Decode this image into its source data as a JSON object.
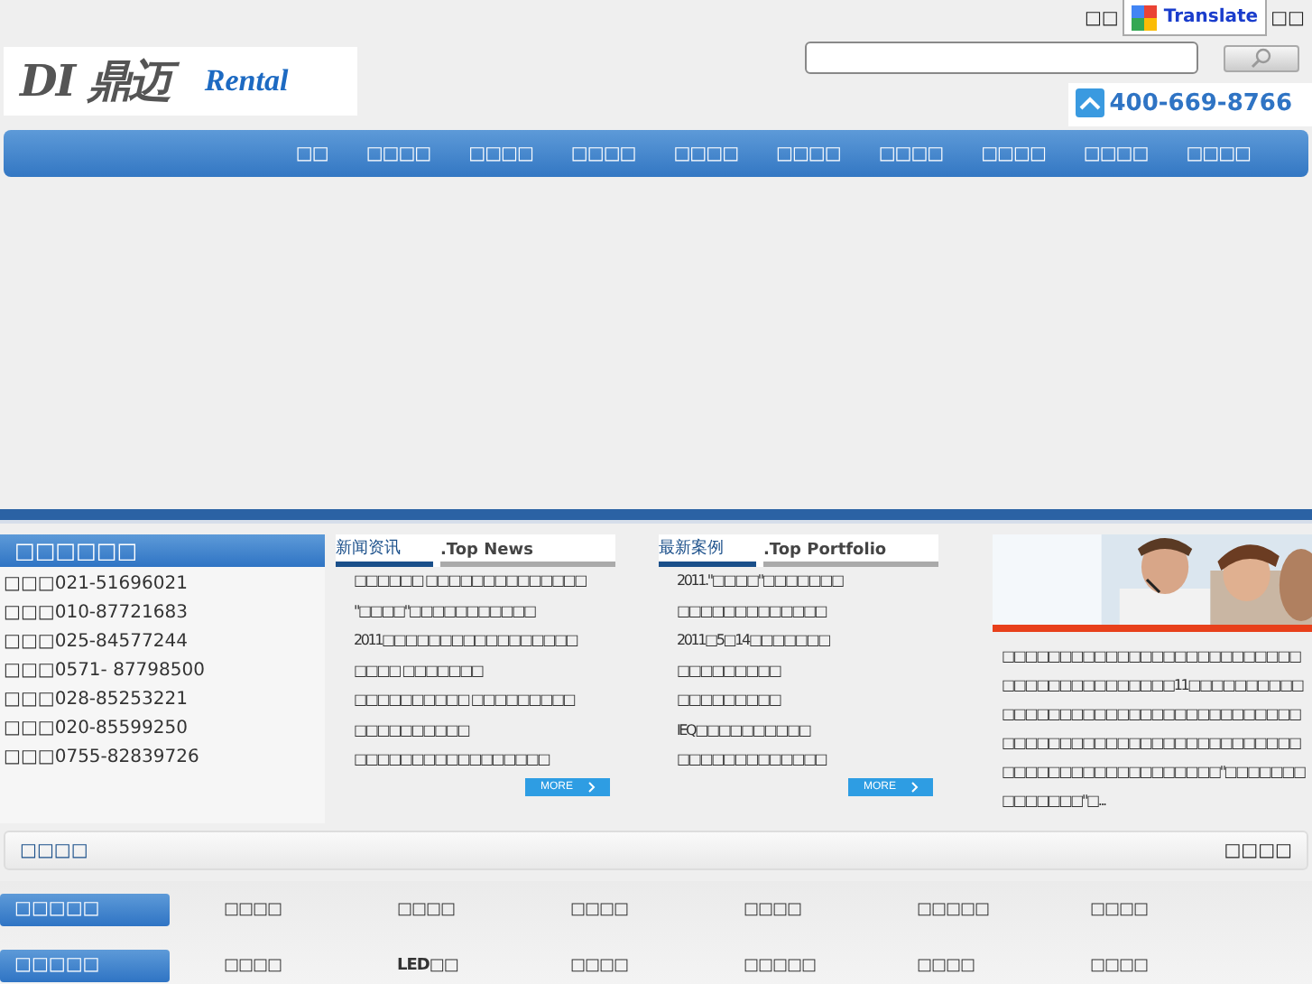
{
  "top_links": [
    "□□",
    "□□"
  ],
  "translate": {
    "label": "Translate"
  },
  "logo": {
    "mark": "DI 鼎迈",
    "tagline": "Rental"
  },
  "hotline": "400-669-8766",
  "nav": [
    {
      "label": "□□",
      "selected": false
    },
    {
      "label": "□□□□",
      "selected": false
    },
    {
      "label": "□□□□",
      "selected": false
    },
    {
      "label": "□□□□",
      "selected": false
    },
    {
      "label": "□□□□",
      "selected": false
    },
    {
      "label": "□□□□",
      "selected": false
    },
    {
      "label": "□□□□",
      "selected": false
    },
    {
      "label": "□□□□",
      "selected": false
    },
    {
      "label": "□□□□",
      "selected": false
    },
    {
      "label": "□□□□",
      "selected": false
    }
  ],
  "contacts": {
    "title": "□□□□□□",
    "lines": [
      "□□□021-51696021",
      "□□□010-87721683",
      "□□□025-84577244",
      "□□□0571- 87798500",
      "□□□028-85253221",
      "□□□020-85599250",
      "□□□0755-82839726"
    ]
  },
  "news": {
    "title": "新闻资讯",
    "subtitle": ".Top News",
    "more": "MORE",
    "items": [
      "□□□□□□ □□□□□□□□□□□□□□",
      "\"□□□□\"□□□□□□□□□□□",
      "2011□□□□□□□□□□□□□□□□□",
      "□□□□ □□□□□□□",
      "□□□□□□□□□□ □□□□□□□□□",
      "□□□□□□□□□□",
      "□□□□□□□□□□□□□□□□□"
    ]
  },
  "portfolio": {
    "title": "最新案例",
    "subtitle": ".Top Portfolio",
    "more": "MORE",
    "items": [
      "2011.\"□□□□\"□□□□□□□",
      "□□□□□□□□□□□□□",
      "2011□5□14□□□□□□□",
      "□□□□□□□□□",
      "□□□□□□□□□",
      "IEQ□□□□□□□□□□",
      "□□□□□□□□□□□□□"
    ]
  },
  "about": {
    "kind": "picture",
    "text": "□□□□□□□□□□□□□□□□□□□□□□□□□□□□□□□□□□□□□□□□□11□□□□□□□□□□□□□□□□□□□□□□□□□□□□□□□□□□□□□□□□□□□□□□□□□□□□□□□□□□□□□□□□□□□□□□□□□□□□□□□□□\"□□□□□□□□□□□□□□\"□..."
  },
  "links_bar": {
    "title": "□□□□",
    "right": "□□□□"
  },
  "categories": [
    {
      "label": "□□□□□",
      "items": [
        "□□□□",
        "□□□□",
        "□□□□",
        "□□□□",
        "□□□□□",
        "□□□□"
      ]
    },
    {
      "label": "□□□□□",
      "items": [
        "□□□□",
        "LED□□",
        "□□□□",
        "□□□□□",
        "□□□□",
        "□□□□"
      ]
    }
  ]
}
